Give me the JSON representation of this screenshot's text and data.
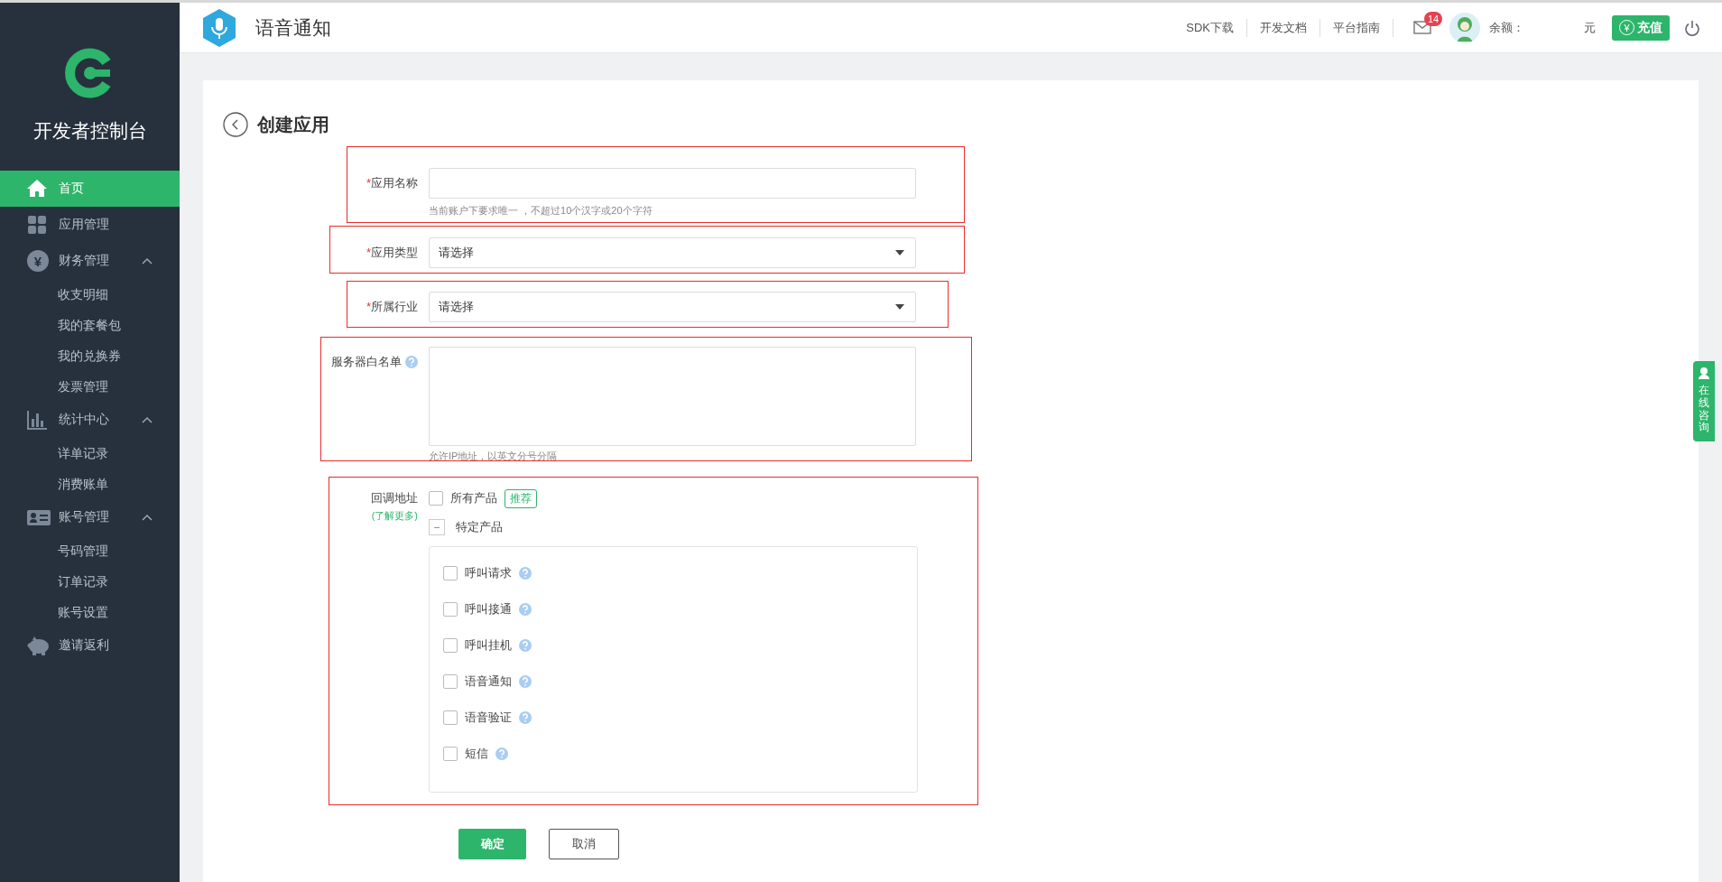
{
  "sidebar": {
    "title": "开发者控制台",
    "items": [
      {
        "label": "首页",
        "kind": "home",
        "selected": true
      },
      {
        "label": "应用管理",
        "kind": "grid",
        "selected": false
      },
      {
        "label": "财务管理",
        "kind": "yen",
        "icon_text": "¥",
        "selected": false,
        "expanded": true,
        "children": [
          {
            "label": "收支明细",
            "selected": false
          },
          {
            "label": "我的套餐包",
            "selected": false
          },
          {
            "label": "我的兑换券",
            "selected": false
          },
          {
            "label": "发票管理",
            "selected": false
          }
        ]
      },
      {
        "label": "统计中心",
        "kind": "chart",
        "selected": false,
        "expanded": true,
        "children": [
          {
            "label": "详单记录",
            "selected": false
          },
          {
            "label": "消费账单",
            "selected": false
          }
        ]
      },
      {
        "label": "账号管理",
        "kind": "card",
        "selected": false,
        "expanded": true,
        "children": [
          {
            "label": "号码管理",
            "selected": false
          },
          {
            "label": "订单记录",
            "selected": false
          },
          {
            "label": "账号设置",
            "selected": false
          }
        ]
      },
      {
        "label": "邀请返利",
        "kind": "piggy",
        "selected": false
      }
    ]
  },
  "header": {
    "app_name": "语音通知",
    "links": [
      "SDK下载",
      "开发文档",
      "平台指南"
    ],
    "mail_count": "14",
    "balance_label": "余额：",
    "balance_unit": "元",
    "recharge_icon": "¥",
    "recharge_button": "充值"
  },
  "page": {
    "title": "创建应用"
  },
  "fields": [
    {
      "kind": "text",
      "required_mark": "*",
      "label": "应用名称",
      "hint": "当前账户下要求唯一 ，不超过10个汉字或20个字符",
      "highlighted": true
    },
    {
      "kind": "select",
      "required_mark": "*",
      "label": "应用类型",
      "value": "请选择",
      "highlighted": true
    },
    {
      "kind": "select",
      "required_mark": "*",
      "label": "所属行业",
      "value": "请选择",
      "highlighted": true
    },
    {
      "kind": "textarea",
      "label": "服务器白名单",
      "help": true,
      "hint": "允许IP地址，以英文分号分隔",
      "highlighted": true
    },
    {
      "kind": "callback",
      "label": "回调地址",
      "link": "(了解更多)",
      "highlighted": true,
      "all_products": {
        "label": "所有产品",
        "checked": false,
        "badge": "推荐"
      },
      "specific_products": {
        "label": "特定产品",
        "expanded": true,
        "items": [
          {
            "label": "呼叫请求",
            "checked": false,
            "help": true
          },
          {
            "label": "呼叫接通",
            "checked": false,
            "help": true
          },
          {
            "label": "呼叫挂机",
            "checked": false,
            "help": true
          },
          {
            "label": "语音通知",
            "checked": false,
            "help": true
          },
          {
            "label": "语音验证",
            "checked": false,
            "help": true
          },
          {
            "label": "短信",
            "checked": false,
            "help": true
          }
        ]
      }
    }
  ],
  "buttons": [
    {
      "kind": "primary",
      "label": "确定"
    },
    {
      "kind": "secondary",
      "label": "取消"
    }
  ],
  "chat_tab": {
    "label": "在线咨询"
  }
}
